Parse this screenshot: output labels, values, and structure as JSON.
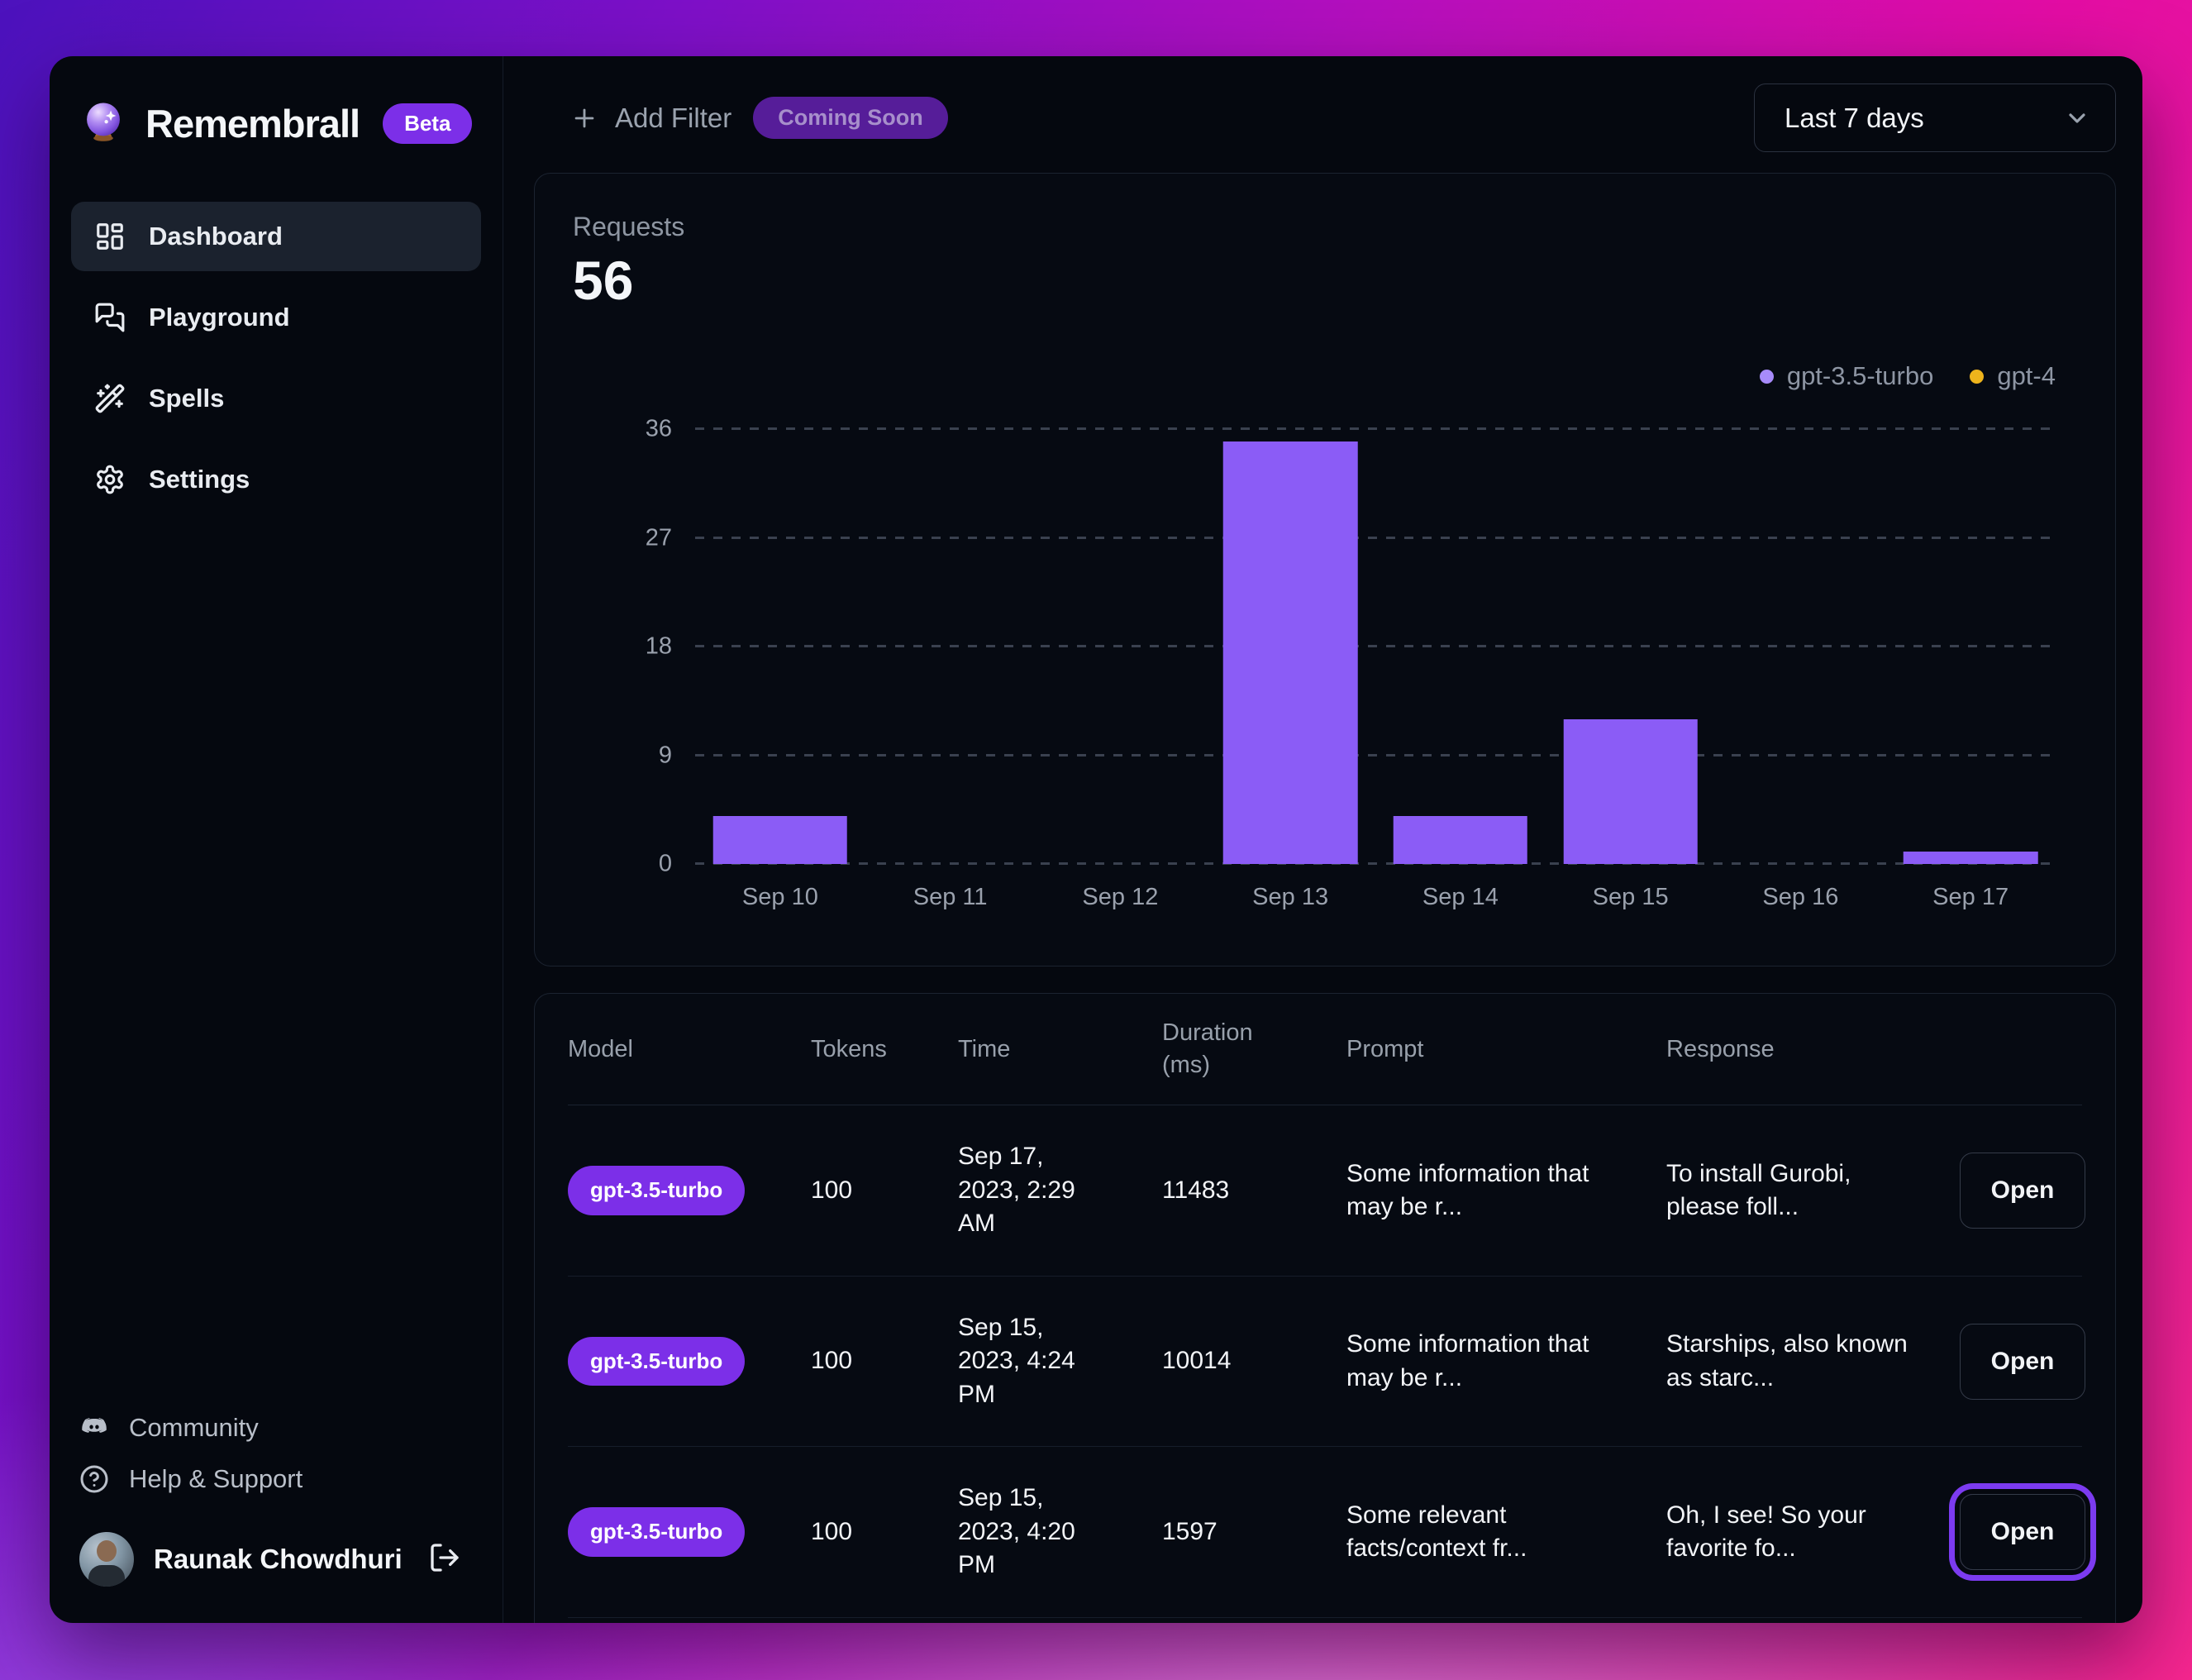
{
  "app": {
    "name": "Remembrall",
    "badge": "Beta"
  },
  "sidebar": {
    "items": [
      {
        "label": "Dashboard",
        "icon": "layout-dashboard-icon",
        "active": true
      },
      {
        "label": "Playground",
        "icon": "chat-bubbles-icon",
        "active": false
      },
      {
        "label": "Spells",
        "icon": "magic-wand-icon",
        "active": false
      },
      {
        "label": "Settings",
        "icon": "gear-icon",
        "active": false
      }
    ],
    "footer_links": [
      {
        "label": "Community",
        "icon": "discord-icon"
      },
      {
        "label": "Help & Support",
        "icon": "help-circle-icon"
      }
    ],
    "user": {
      "name": "Raunak Chowdhuri",
      "logout_icon": "logout-icon"
    }
  },
  "toolbar": {
    "add_filter_label": "Add Filter",
    "add_filter_icon": "plus-icon",
    "coming_soon_badge": "Coming Soon",
    "date_range_value": "Last 7 days",
    "date_range_icon": "chevron-down-icon"
  },
  "chart_data": {
    "type": "bar",
    "title": "Requests",
    "total": "56",
    "categories": [
      "Sep 10",
      "Sep 11",
      "Sep 12",
      "Sep 13",
      "Sep 14",
      "Sep 15",
      "Sep 16",
      "Sep 17"
    ],
    "series": [
      {
        "name": "gpt-3.5-turbo",
        "color": "#8b5cf6",
        "legend_color": "#a78bfa",
        "values": [
          4,
          0,
          0,
          35,
          4,
          12,
          0,
          1
        ]
      },
      {
        "name": "gpt-4",
        "color": "#eab308",
        "legend_color": "#eeb41c",
        "values": [
          0,
          0,
          0,
          0,
          0,
          0,
          0,
          0
        ]
      }
    ],
    "ylim": [
      0,
      36
    ],
    "yticks": [
      0,
      9,
      18,
      27,
      36
    ],
    "grid": "horizontal-dashed",
    "legend_position": "top-right"
  },
  "table": {
    "headers": [
      "Model",
      "Tokens",
      "Time",
      "Duration (ms)",
      "Prompt",
      "Response"
    ],
    "open_label": "Open",
    "rows": [
      {
        "model": "gpt-3.5-turbo",
        "tokens": "100",
        "time": "Sep 17, 2023, 2:29 AM",
        "duration": "11483",
        "prompt": "Some information that may be r...",
        "response": "To install Gurobi, please foll..."
      },
      {
        "model": "gpt-3.5-turbo",
        "tokens": "100",
        "time": "Sep 15, 2023, 4:24 PM",
        "duration": "10014",
        "prompt": "Some information that may be r...",
        "response": "Starships, also known as starc..."
      },
      {
        "model": "gpt-3.5-turbo",
        "tokens": "100",
        "time": "Sep 15, 2023, 4:20 PM",
        "duration": "1597",
        "prompt": "Some relevant facts/context fr...",
        "response": "Oh, I see! So your favorite fo..."
      }
    ]
  },
  "colors": {
    "accent_purple": "#7c2fe8",
    "bar_purple": "#8b5cf6",
    "legend_amber": "#eeb41c",
    "window_bg": "#05080f",
    "grid_dash": "#3a414f"
  }
}
